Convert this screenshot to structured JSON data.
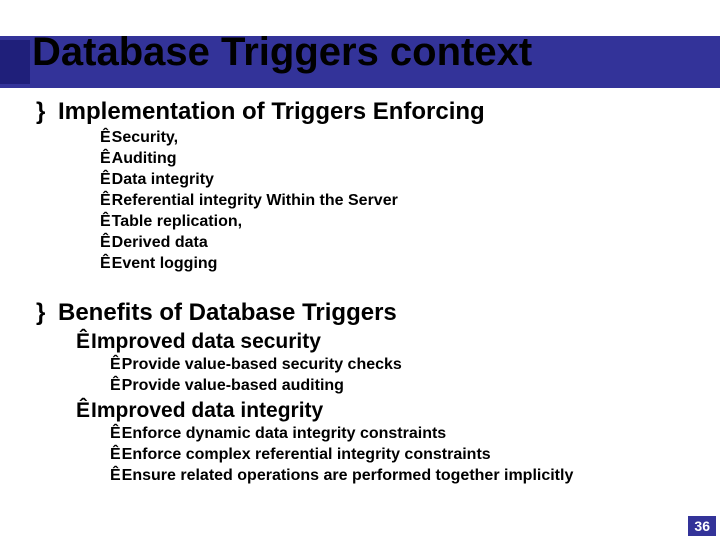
{
  "title": "Database Triggers context",
  "arrow_glyph": "Ê",
  "bullet_glyph": "}",
  "sections": [
    {
      "heading": "Implementation of Triggers Enforcing",
      "items": [
        "Security,",
        "Auditing",
        "Data integrity",
        "Referential integrity Within the Server",
        "Table replication,",
        "Derived data",
        "Event logging"
      ]
    },
    {
      "heading": "Benefits of Database Triggers",
      "subsections": [
        {
          "heading": "Improved data security",
          "items": [
            "Provide value-based security checks",
            "Provide value-based auditing"
          ]
        },
        {
          "heading": "Improved data integrity",
          "items": [
            "Enforce dynamic data integrity constraints",
            "Enforce complex referential integrity constraints",
            "Ensure related operations are performed together implicitly"
          ]
        }
      ]
    }
  ],
  "page_number": "36"
}
